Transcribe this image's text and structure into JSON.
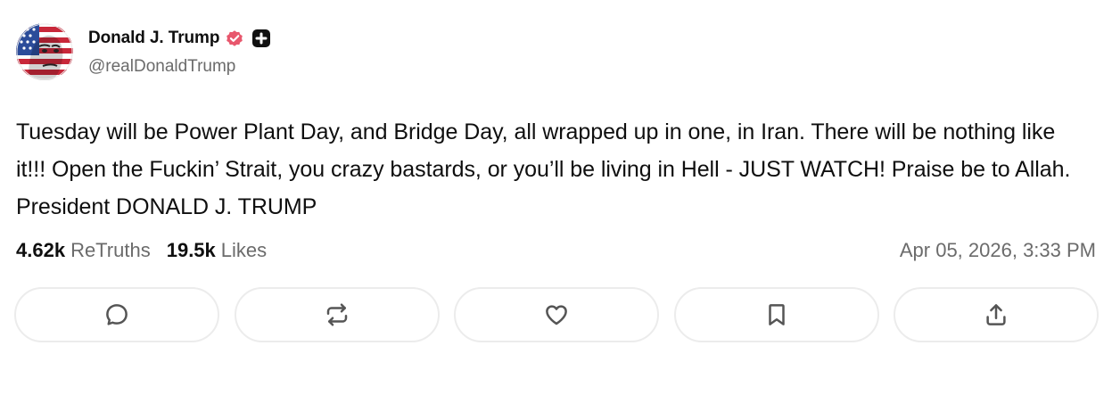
{
  "author": {
    "display_name": "Donald J. Trump",
    "handle": "@realDonaldTrump",
    "avatar_icon": "flag-face-avatar",
    "verified_icon": "verified-badge-icon",
    "verified_color": "#e8576d",
    "plus_icon": "plus-box-icon"
  },
  "post": {
    "text": "Tuesday will be Power Plant Day, and Bridge Day, all wrapped up in one, in Iran. There will be nothing like it!!! Open the Fuckin’ Strait, you crazy bastards, or you’ll be living in Hell - JUST WATCH! Praise be to Allah. President DONALD J. TRUMP",
    "retruths_count": "4.62k",
    "retruths_label": "ReTruths",
    "likes_count": "19.5k",
    "likes_label": "Likes",
    "timestamp": "Apr 05, 2026, 3:33 PM"
  },
  "actions": [
    {
      "name": "reply",
      "icon": "comment-icon"
    },
    {
      "name": "retruth",
      "icon": "repost-icon"
    },
    {
      "name": "like",
      "icon": "heart-icon"
    },
    {
      "name": "bookmark",
      "icon": "bookmark-icon"
    },
    {
      "name": "share",
      "icon": "share-icon"
    }
  ],
  "colors": {
    "text": "#0f0f0f",
    "muted": "#6b6b6b",
    "button_border": "#ececec",
    "icon": "#555555"
  }
}
